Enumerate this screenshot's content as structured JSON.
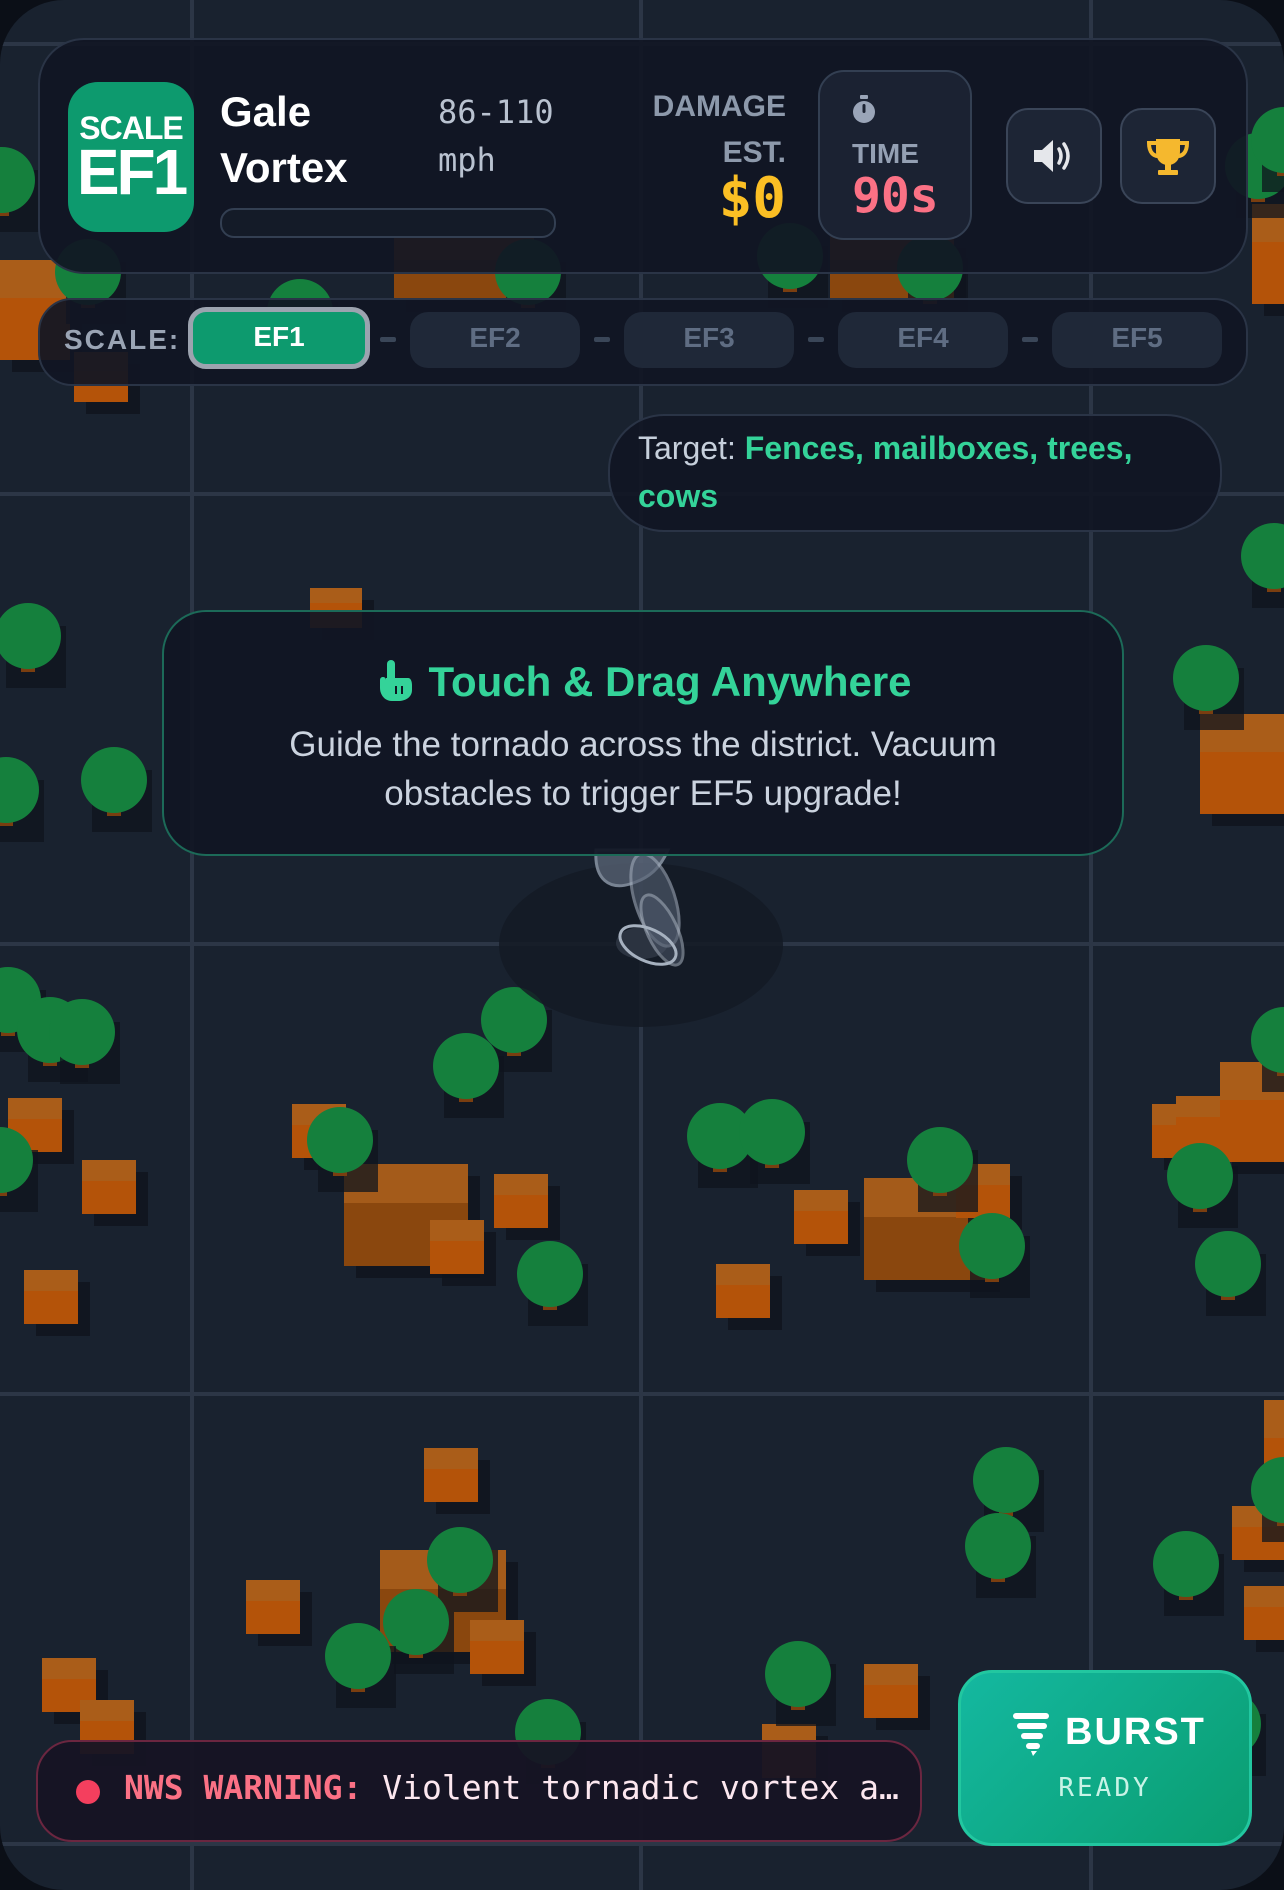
{
  "header": {
    "scale_caption": "SCALE",
    "scale_value": "EF1",
    "storm_name": "Gale Vortex",
    "wind_speed": "86-110 mph",
    "progress": 0,
    "damage_label": "DAMAGE EST.",
    "damage_value": "$0",
    "time_label": "TIME",
    "time_value": "90s",
    "timer_icon": "stopwatch-icon",
    "sound_icon": "speaker-icon",
    "trophy_icon": "trophy-icon"
  },
  "scale": {
    "label": "SCALE:",
    "levels": [
      "EF1",
      "EF2",
      "EF3",
      "EF4",
      "EF5"
    ],
    "active": "EF1"
  },
  "target": {
    "prefix": "Target:",
    "value": "Fences, mailboxes, trees, cows"
  },
  "hint": {
    "icon": "pointer-hand-icon",
    "title": "Touch & Drag Anywhere",
    "body": "Guide the tornado across the district. Vacuum obstacles to trigger EF5 upgrade!"
  },
  "warning": {
    "label": "NWS WARNING:",
    "text": "Violent tornadic vortex a…"
  },
  "burst": {
    "icon": "tornado-icon",
    "label": "BURST",
    "state": "READY"
  },
  "colors": {
    "accent": "#10b981",
    "damage": "#fbbf24",
    "time": "#fb7185",
    "warning": "#f43f5e",
    "tree": "#15803d",
    "house": "#b45309"
  }
}
